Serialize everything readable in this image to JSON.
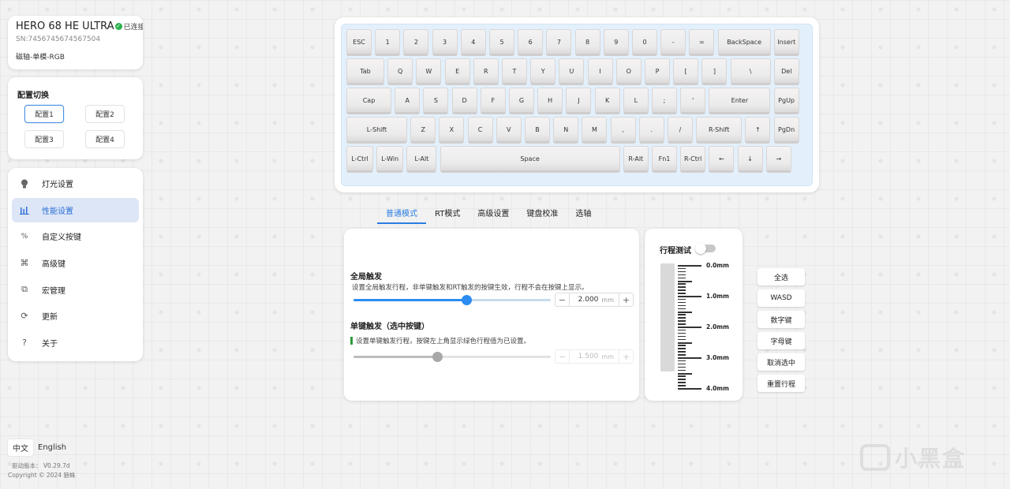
{
  "device": {
    "name": "HERO 68 HE ULTRA",
    "status": "已连接",
    "sn": "SN:7456745674567504",
    "type": "磁轴-单模-RGB"
  },
  "profile": {
    "title": "配置切换",
    "items": [
      "配置1",
      "配置2",
      "配置3",
      "配置4"
    ],
    "active": 0
  },
  "menu": {
    "items": [
      {
        "label": "灯光设置",
        "icon": "lightbulb-icon"
      },
      {
        "label": "性能设置",
        "icon": "performance-bars-icon"
      },
      {
        "label": "自定义按键",
        "icon": "custom-key-icon"
      },
      {
        "label": "高级键",
        "icon": "advanced-key-icon"
      },
      {
        "label": "宏管理",
        "icon": "macro-icon"
      },
      {
        "label": "更新",
        "icon": "refresh-icon"
      },
      {
        "label": "关于",
        "icon": "question-icon"
      }
    ],
    "active": 1
  },
  "language": {
    "zh": "中文",
    "en": "English"
  },
  "footer": {
    "version": "驱动版本： V0.29.7d",
    "copyright": "Copyright © 2024 狼蛛"
  },
  "keyboard": {
    "rows": [
      [
        "ESC",
        "1",
        "2",
        "3",
        "4",
        "5",
        "6",
        "7",
        "8",
        "9",
        "0",
        "-",
        "=",
        "BackSpace",
        "Insert"
      ],
      [
        "Tab",
        "Q",
        "W",
        "E",
        "R",
        "T",
        "Y",
        "U",
        "I",
        "O",
        "P",
        "[",
        "]",
        "\\",
        "Del"
      ],
      [
        "Cap",
        "A",
        "S",
        "D",
        "F",
        "G",
        "H",
        "J",
        "K",
        "L",
        ";",
        "'",
        "Enter",
        "PgUp"
      ],
      [
        "L-Shift",
        "Z",
        "X",
        "C",
        "V",
        "B",
        "N",
        "M",
        ",",
        ".",
        "/",
        "R-Shift",
        "↑",
        "PgDn"
      ],
      [
        "L-Ctrl",
        "L-Win",
        "L-Alt",
        "Space",
        "R-Alt",
        "Fn1",
        "R-Ctrl",
        "←",
        "↓",
        "→"
      ]
    ]
  },
  "tabs": {
    "items": [
      "普通模式",
      "RT模式",
      "高级设置",
      "键盘校准",
      "选轴"
    ],
    "active": 0
  },
  "global_trigger": {
    "title": "全局触发",
    "desc": "设置全局触发行程，非单键触发和RT触发的按键生效，行程不会在按键上显示。",
    "value": "2.000",
    "unit": "mm",
    "fraction": 0.575,
    "minus": "−",
    "plus": "+"
  },
  "single_trigger": {
    "title": "单键触发（选中按键）",
    "desc": "设置单键触发行程，按键左上角显示绿色行程值为已设置。",
    "value": "1.500",
    "unit": "mm",
    "fraction": 0.425,
    "minus": "−",
    "plus": "+"
  },
  "travel_test": {
    "title": "行程测试",
    "enabled": false,
    "labels": [
      "0.0mm",
      "1.0mm",
      "2.0mm",
      "3.0mm",
      "4.0mm"
    ]
  },
  "select_buttons": [
    "全选",
    "WASD",
    "数字键",
    "字母键",
    "取消选中",
    "重置行程"
  ],
  "watermark": {
    "text": "小黑盒"
  },
  "colors": {
    "accent": "#2b7de0",
    "active_menu_bg": "#dce6f7",
    "status_green": "#2bb24c",
    "keyboard_bg": "#e3f0fb"
  }
}
